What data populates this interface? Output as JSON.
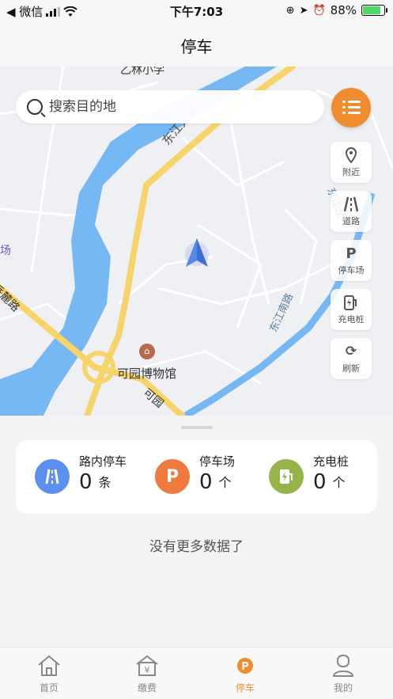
{
  "status_bar": {
    "carrier": "◀ 微信",
    "time": "下午7:03",
    "battery_percent": "88%"
  },
  "nav": {
    "title": "停车"
  },
  "map": {
    "search_placeholder": "搜索目的地",
    "labels": {
      "top_area": "乙林小学",
      "road_dongjiang": "东江大道",
      "road_north": "东江北",
      "road_lower_right": "东江南路",
      "road_left": "岳麓路",
      "area_left": "场",
      "museum": "可园博物馆",
      "road_bottom": "可园"
    },
    "tools": [
      {
        "icon": "location-pin-icon",
        "label": "附近"
      },
      {
        "icon": "road-icon",
        "label": "道路"
      },
      {
        "icon": "parking-icon",
        "label": "停车场"
      },
      {
        "icon": "charger-icon",
        "label": "充电桩"
      },
      {
        "icon": "refresh-icon",
        "label": "刷新"
      }
    ]
  },
  "summary": {
    "items": [
      {
        "title": "路内停车",
        "count": "0",
        "unit": "条",
        "color": "#5d8ff0"
      },
      {
        "title": "停车场",
        "count": "0",
        "unit": "个",
        "color": "#ee7a3e"
      },
      {
        "title": "充电桩",
        "count": "0",
        "unit": "个",
        "color": "#97b34a"
      }
    ]
  },
  "empty_text": "没有更多数据了",
  "tabs": [
    {
      "label": "首页",
      "active": false
    },
    {
      "label": "缴费",
      "active": false
    },
    {
      "label": "停车",
      "active": true
    },
    {
      "label": "我的",
      "active": false
    }
  ],
  "colors": {
    "accent": "#ef8c2e",
    "river": "#76b8f3",
    "main_road": "#f7d46a"
  }
}
